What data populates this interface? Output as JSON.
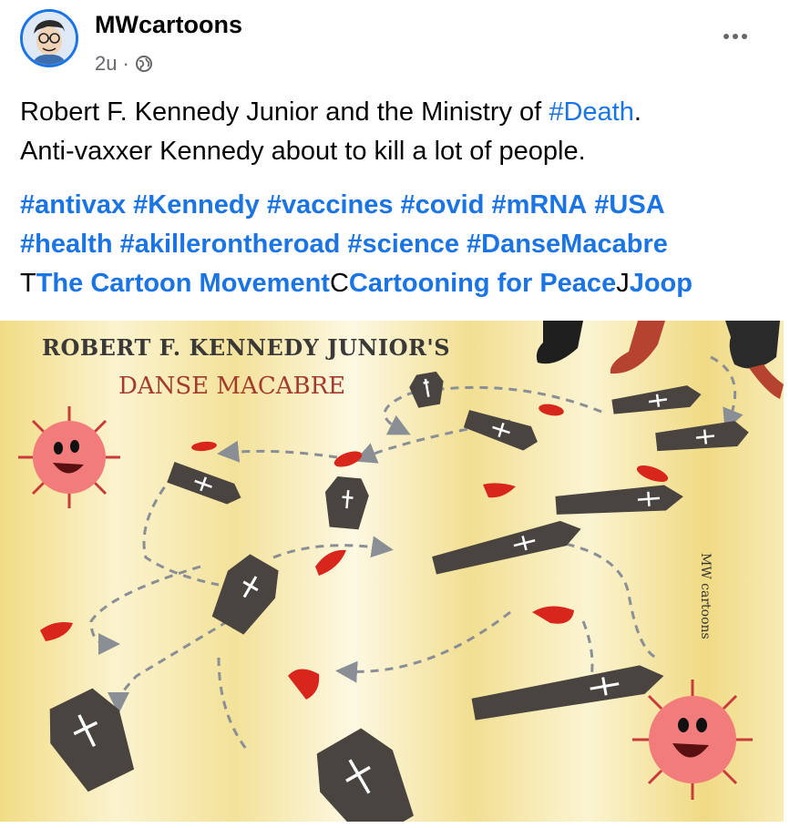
{
  "post": {
    "author": "MWcartoons",
    "time": "2u",
    "separator": "·",
    "privacy_icon": "globe-icon",
    "more_icon": "more-dots-icon",
    "text_line1_prefix": "Robert F. Kennedy Junior and the Ministry of ",
    "text_line1_tag": "#Death",
    "text_line1_suffix": ".",
    "text_line2": "Anti-vaxxer Kennedy about to kill a lot of people.",
    "hashtags": [
      "#antivax",
      "#Kennedy",
      "#vaccines",
      "#covid",
      "#mRNA",
      "#USA",
      "#health",
      "#akillerontheroad",
      "#science",
      "#DanseMacabre"
    ],
    "mentions": [
      {
        "initial": "T",
        "name": "The Cartoon Movement"
      },
      {
        "initial": "C",
        "name": "Cartooning for Peace"
      },
      {
        "initial": "J",
        "name": "Joop"
      }
    ]
  },
  "cartoon": {
    "title_line1": "ROBERT F. KENNEDY JUNIOR'S",
    "title_line2": "DANSE MACABRE",
    "signature": "MW cartoons",
    "colors": {
      "background": "#f3e6a4",
      "stripe": "#fbf6dc",
      "coffin": "#4a4440",
      "footprint": "#d8261c",
      "virus": "#f27b7b",
      "arrow": "#8a8f96",
      "title_dark": "#3b3838",
      "title_red": "#a33b2e"
    }
  }
}
